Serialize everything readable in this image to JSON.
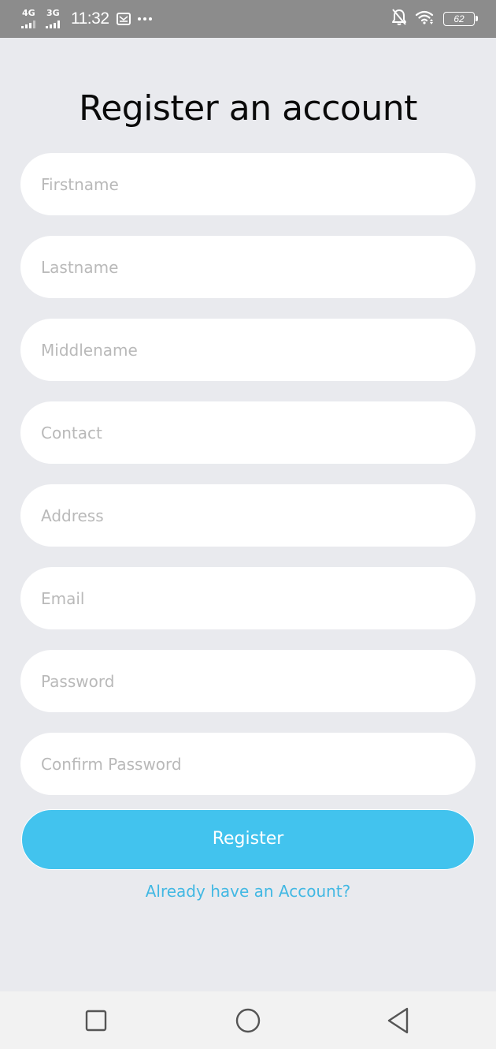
{
  "status_bar": {
    "network_1": "4G",
    "network_2": "3G",
    "time": "11:32",
    "battery_level": "62",
    "icons": [
      "signal-icon",
      "message-icon",
      "more-dots-icon",
      "bell-off-icon",
      "wifi-icon",
      "battery-icon"
    ]
  },
  "page": {
    "title": "Register an account"
  },
  "form": {
    "firstname_placeholder": "Firstname",
    "lastname_placeholder": "Lastname",
    "middlename_placeholder": "Middlename",
    "contact_placeholder": "Contact",
    "address_placeholder": "Address",
    "email_placeholder": "Email",
    "password_placeholder": "Password",
    "confirm_password_placeholder": "Confirm Password",
    "register_label": "Register",
    "login_link": "Already have an Account?"
  },
  "nav": {
    "icons": [
      "recent-apps-icon",
      "home-icon",
      "back-icon"
    ]
  },
  "colors": {
    "background": "#e9eaee",
    "status_bar": "#8c8c8c",
    "accent": "#42c3ee",
    "link": "#42b8e3",
    "field": "#ffffff"
  }
}
